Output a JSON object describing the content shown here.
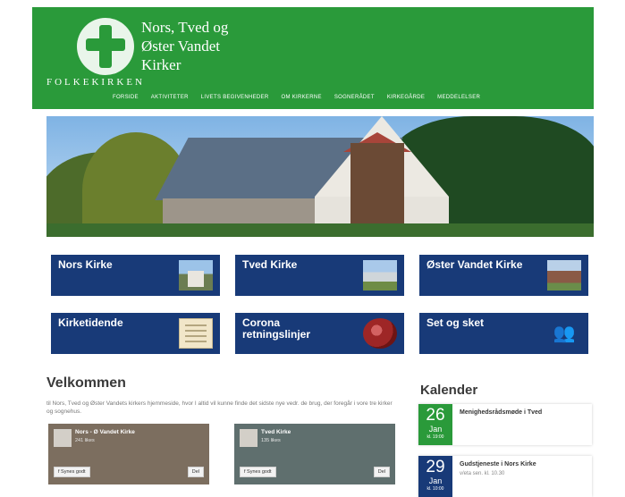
{
  "header": {
    "title_lines": [
      "Nors, Tved og",
      "Øster Vandet",
      "Kirker"
    ],
    "brand": "FOLKEKIRKEN",
    "nav": [
      "FORSIDE",
      "AKTIVITETER",
      "LIVETS BEGIVENHEDER",
      "OM KIRKERNE",
      "SOGNERÅDET",
      "KIRKEGÅRDE",
      "MEDDELELSER"
    ],
    "green": "#2a9a3a"
  },
  "tiles": [
    {
      "label": "Nors Kirke",
      "icon": "church-photo"
    },
    {
      "label": "Tved Kirke",
      "icon": "church-photo"
    },
    {
      "label": "Øster Vandet Kirke",
      "icon": "church-photo"
    },
    {
      "label": "Kirketidende",
      "icon": "newspaper-icon"
    },
    {
      "label": "Corona retningslinjer",
      "icon": "virus-icon"
    },
    {
      "label": "Set og sket",
      "icon": "people-icon"
    }
  ],
  "welcome": {
    "title": "Velkommen",
    "text": "til Nors, Tved og Øster Vandets kirkers hjemmeside, hvor I altid vil kunne finde det sidste nye vedr. de brug, der foregår i vore tre kirker og sognehus.",
    "feeds": [
      {
        "name": "Nors - Ø Vandet Kirke",
        "likes": "241 likes",
        "left_btn": "f Synes godt",
        "right_btn": "Del"
      },
      {
        "name": "Tved Kirke",
        "likes": "135 likes",
        "left_btn": "f Synes godt",
        "right_btn": "Del"
      }
    ]
  },
  "calendar": {
    "title": "Kalender",
    "events": [
      {
        "day": "26",
        "month": "Jan",
        "time": "kl. 19:00",
        "title": "Menighedsrådsmøde i Tved",
        "subtitle": ""
      },
      {
        "day": "29",
        "month": "Jan",
        "time": "kl. 10:00",
        "title": "Gudstjeneste i Nors Kirke",
        "subtitle": "v/eta sen. kl. 10.30"
      }
    ],
    "colors": {
      "first": "#2a9a3a",
      "second": "#183a78"
    }
  },
  "tile_color": "#183a78"
}
